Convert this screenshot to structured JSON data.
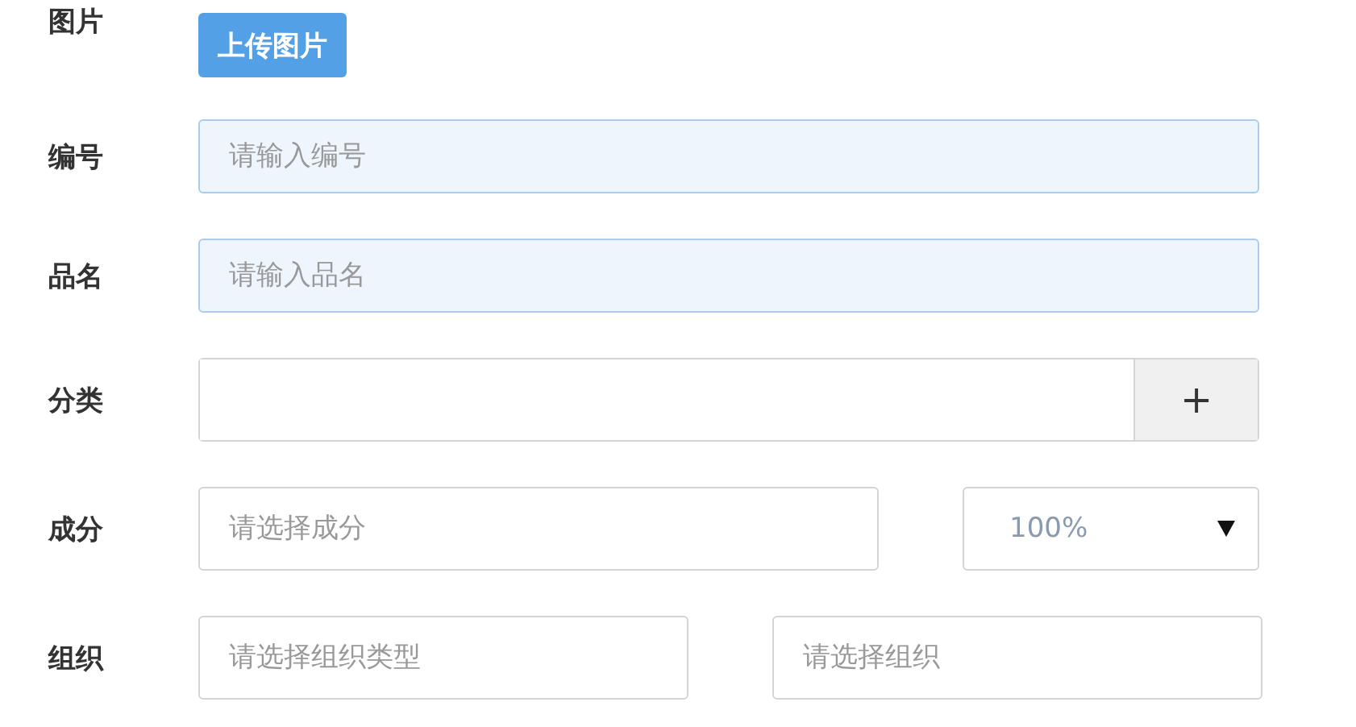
{
  "rows": [
    {
      "kind": "upload",
      "label": "图片",
      "button": "上传图片"
    },
    {
      "kind": "text",
      "label": "编号",
      "placeholder": "请输入编号",
      "highlighted": true
    },
    {
      "kind": "text",
      "label": "品名",
      "placeholder": "请输入品名",
      "highlighted": true
    },
    {
      "kind": "add",
      "label": "分类",
      "button": "+"
    },
    {
      "kind": "select",
      "label": "成分",
      "placeholder": "请选择成分",
      "select": "100%"
    },
    {
      "kind": "pair",
      "label": "组织",
      "placeholders": [
        "请选择组织类型",
        "请选择组织"
      ]
    }
  ]
}
